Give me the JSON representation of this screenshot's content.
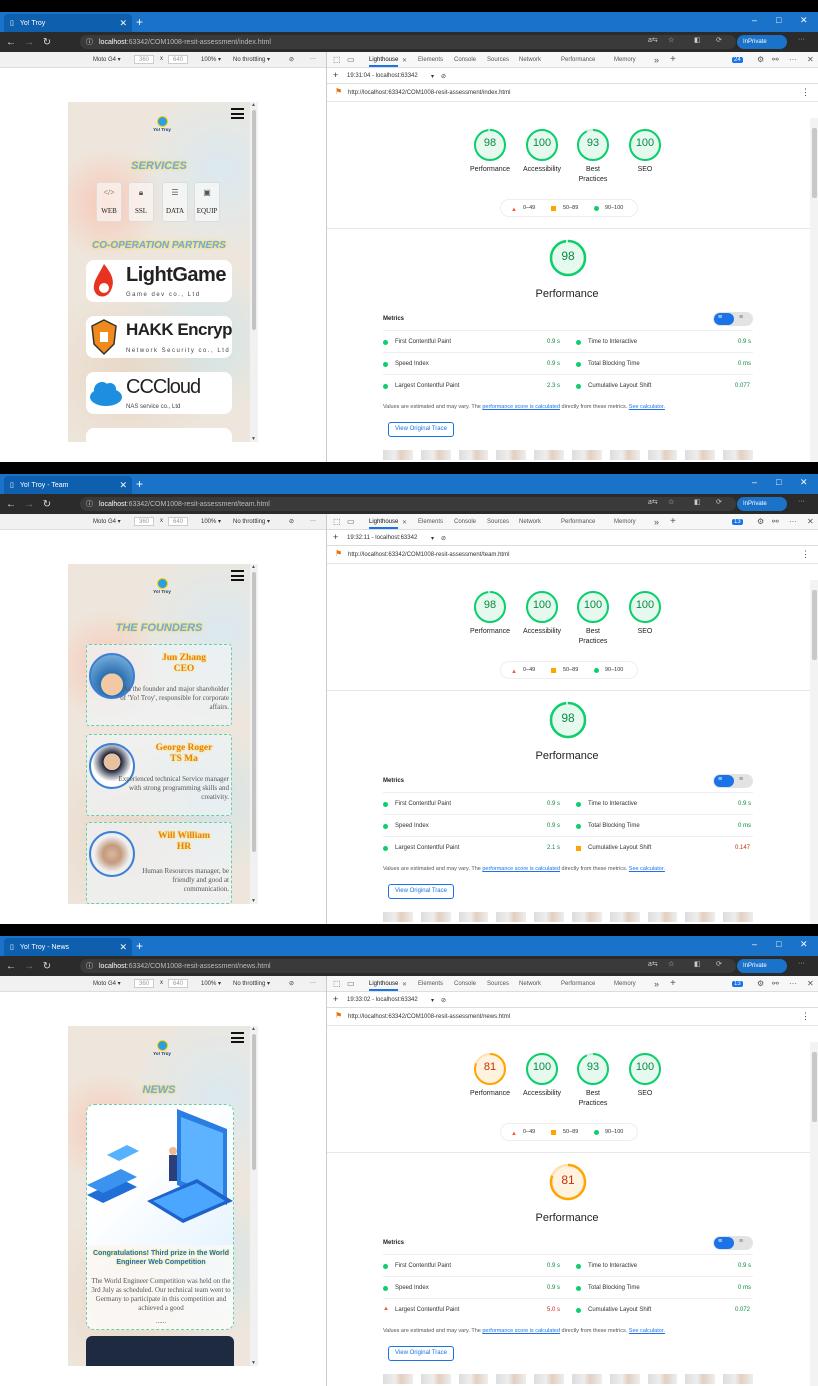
{
  "windows": [
    {
      "tab_title": "Yo! Troy",
      "url_host": "localhost",
      "url_path": ":63342/COM1008-resit-assessment/index.html",
      "issues_badge": "24",
      "report_time": "19:31:04 - localhost:63342",
      "report_url": "http://localhost:63342/COM1008-resit-assessment/index.html",
      "scores": {
        "performance": "98",
        "accessibility": "100",
        "best_practices": "93",
        "seo": "100"
      },
      "score_values": {
        "performance": 98,
        "accessibility": 100,
        "best_practices": 93,
        "seo": 100
      },
      "metrics": {
        "fcp": "0.9 s",
        "tti": "0.9 s",
        "si": "0.9 s",
        "tbt": "0 ms",
        "lcp": "2.3 s",
        "cls": "0.077",
        "lcp_status": "good",
        "cls_status": "good"
      }
    },
    {
      "tab_title": "Yo! Troy - Team",
      "url_host": "localhost",
      "url_path": ":63342/COM1008-resit-assessment/team.html",
      "issues_badge": "13",
      "report_time": "19:32:11 - localhost:63342",
      "report_url": "http://localhost:63342/COM1008-resit-assessment/team.html",
      "scores": {
        "performance": "98",
        "accessibility": "100",
        "best_practices": "100",
        "seo": "100"
      },
      "score_values": {
        "performance": 98,
        "accessibility": 100,
        "best_practices": 100,
        "seo": 100
      },
      "metrics": {
        "fcp": "0.9 s",
        "tti": "0.9 s",
        "si": "0.9 s",
        "tbt": "0 ms",
        "lcp": "2.1 s",
        "cls": "0.147",
        "lcp_status": "good",
        "cls_status": "average"
      }
    },
    {
      "tab_title": "Yo! Troy - News",
      "url_host": "localhost",
      "url_path": ":63342/COM1008-resit-assessment/news.html",
      "issues_badge": "13",
      "report_time": "19:33:02 - localhost:63342",
      "report_url": "http://localhost:63342/COM1008-resit-assessment/news.html",
      "scores": {
        "performance": "81",
        "accessibility": "100",
        "best_practices": "93",
        "seo": "100"
      },
      "score_values": {
        "performance": 81,
        "accessibility": 100,
        "best_practices": 93,
        "seo": 100
      },
      "metrics": {
        "fcp": "0.9 s",
        "tti": "0.9 s",
        "si": "0.9 s",
        "tbt": "0 ms",
        "lcp": "5.0 s",
        "cls": "0.072",
        "lcp_status": "poor",
        "cls_status": "good"
      }
    }
  ],
  "browser": {
    "inprivate": "InPrivate",
    "new_tab": "+",
    "win_min": "–",
    "win_max": "□",
    "win_close": "✕"
  },
  "emulation": {
    "device": "Moto G4 ▾",
    "width": "360",
    "x": "x",
    "height": "640",
    "zoom": "100% ▾",
    "throttle": "No throttling ▾"
  },
  "devtools_tabs": [
    "Lighthouse",
    "Elements",
    "Console",
    "Sources",
    "Network",
    "Performance",
    "Memory"
  ],
  "devtools_more": "»",
  "labels": {
    "performance": "Performance",
    "accessibility": "Accessibility",
    "best_practices_1": "Best",
    "best_practices_2": "Practices",
    "seo": "SEO",
    "legend_red": "0–49",
    "legend_orange": "50–89",
    "legend_green": "90–100",
    "metrics": "Metrics",
    "fcp": "First Contentful Paint",
    "tti": "Time to Interactive",
    "si": "Speed Index",
    "tbt": "Total Blocking Time",
    "lcp": "Largest Contentful Paint",
    "cls": "Cumulative Layout Shift",
    "note_pre": "Values are estimated and may vary. The",
    "note_link1": "performance score is calculated",
    "note_mid": "directly from these metrics.",
    "note_link2": "See calculator.",
    "view_trace": "View Original Trace"
  },
  "site": {
    "logo_text": "Yo! Troy",
    "services_title": "SERVICES",
    "services": [
      "WEB",
      "SSL",
      "DATA",
      "EQUIP"
    ],
    "partners_title": "CO-OPERATION PARTNERS",
    "partners": [
      {
        "name": "LightGame",
        "sub": "Game dev co., Ltd"
      },
      {
        "name": "HAKK Encrypt",
        "sub": "Network Security co., Ltd"
      },
      {
        "name": "CCCloud",
        "sub": "NAS service co., Ltd"
      }
    ],
    "founders_title": "THE FOUNDERS",
    "founders": [
      {
        "name": "Jun Zhang",
        "role": "CEO",
        "desc": "As the founder and major shareholder of 'Yo! Troy', responsible for corporate affairs."
      },
      {
        "name": "George Roger",
        "role": "TS Ma",
        "desc": "Experienced technical Service manager with strong programming skills and creativity."
      },
      {
        "name": "Will William",
        "role": "HR",
        "desc": "Human Resources manager, be friendly and good at communication."
      }
    ],
    "news_title": "NEWS",
    "news": {
      "headline": "Congratulations! Third prize in the World Engineer Web Competition",
      "body": "The World Engineer Competition was held on the 3rd July as scheduled. Our technical team went to Germany to participate in this competition and achieved a good",
      "more": "......"
    }
  },
  "colors": {
    "green": "#0cce6b",
    "orange": "#ffa400",
    "red": "#ff4e42",
    "accent": "#1a73e8"
  }
}
